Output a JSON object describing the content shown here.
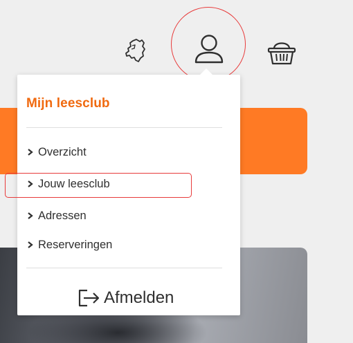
{
  "header": {
    "icons": [
      "netherlands-map-icon",
      "user-account-icon",
      "shopping-basket-icon"
    ]
  },
  "dropdown": {
    "title": "Mijn leesclub",
    "items": [
      {
        "label": "Overzicht"
      },
      {
        "label": "Jouw leesclub"
      },
      {
        "label": "Adressen"
      },
      {
        "label": "Reserveringen"
      }
    ],
    "logout_label": "Afmelden"
  },
  "colors": {
    "brand_orange": "#ff7a24",
    "title_orange": "#f06a10",
    "highlight_red": "#e83a3a",
    "background": "#efefef"
  }
}
